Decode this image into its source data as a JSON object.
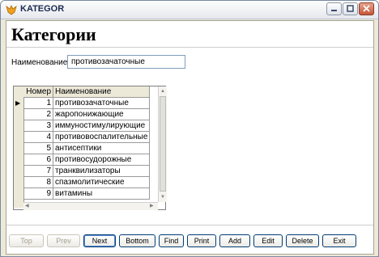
{
  "window": {
    "title": "KATEGOR"
  },
  "page": {
    "heading": "Категории"
  },
  "field": {
    "label": "Наименование",
    "value": "противозачаточные"
  },
  "grid": {
    "columns": [
      "Номер",
      "Наименование"
    ],
    "rows": [
      {
        "num": "1",
        "name": "противозачаточные",
        "current": true
      },
      {
        "num": "2",
        "name": "жаропонижающие"
      },
      {
        "num": "3",
        "name": "иммуностимулирующие"
      },
      {
        "num": "4",
        "name": "противовоспалительные"
      },
      {
        "num": "5",
        "name": "антисептики"
      },
      {
        "num": "6",
        "name": "противосудорожные"
      },
      {
        "num": "7",
        "name": "транквилизаторы"
      },
      {
        "num": "8",
        "name": "спазмолитические"
      },
      {
        "num": "9",
        "name": "витамины"
      }
    ]
  },
  "buttons": [
    {
      "label": "Top",
      "state": "disabled"
    },
    {
      "label": "Prev",
      "state": "disabled"
    },
    {
      "label": "Next",
      "state": "default"
    },
    {
      "label": "Bottom",
      "state": "enabled"
    },
    {
      "label": "Find",
      "state": "enabled"
    },
    {
      "label": "Print",
      "state": "enabled"
    },
    {
      "label": "Add",
      "state": "enabled"
    },
    {
      "label": "Edit",
      "state": "enabled"
    },
    {
      "label": "Delete",
      "state": "enabled"
    },
    {
      "label": "Exit",
      "state": "enabled"
    }
  ],
  "icons": {
    "app": "fox-icon",
    "minimize": "minimize-icon",
    "maximize": "maximize-icon",
    "close": "close-icon",
    "row_indicator": "row-pointer-icon"
  },
  "colors": {
    "title_text": "#1a2a50",
    "close_button": "#c4553a",
    "focus_border": "#5b8bd6"
  }
}
